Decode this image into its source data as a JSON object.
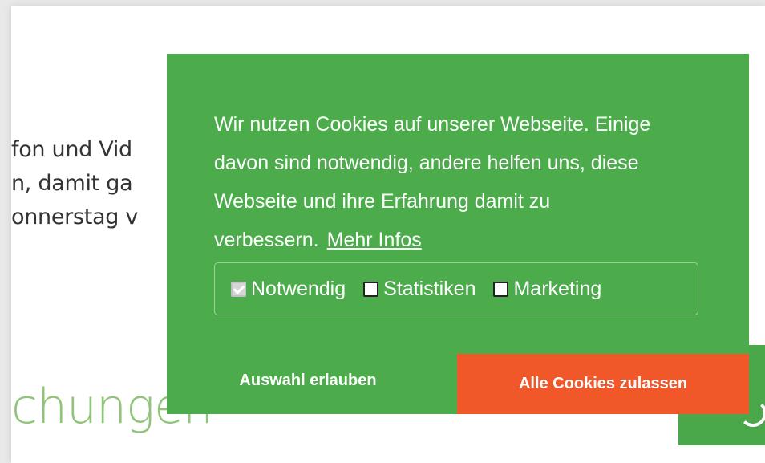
{
  "background": {
    "text_lines": [
      "fon und Vid",
      "n, damit ga",
      "onnerstag v"
    ],
    "heading": "chungen"
  },
  "cookie_banner": {
    "message": "Wir nutzen Cookies auf unserer Webseite. Einige davon sind notwendig, andere helfen uns, diese Webseite und ihre Erfahrung da­mit zu verbessern.",
    "more_info_link": "Mehr Infos",
    "options": [
      {
        "label": "Notwendig",
        "checked": true,
        "disabled": true
      },
      {
        "label": "Statistiken",
        "checked": false
      },
      {
        "label": "Marketing",
        "checked": false
      }
    ],
    "allow_selection_button": "Auswahl erlauben",
    "allow_all_button": "Alle Cookies zulassen"
  },
  "colors": {
    "banner_green": "#4cac4c",
    "accent_orange": "#f0582a",
    "heading_green": "#8fc479"
  }
}
